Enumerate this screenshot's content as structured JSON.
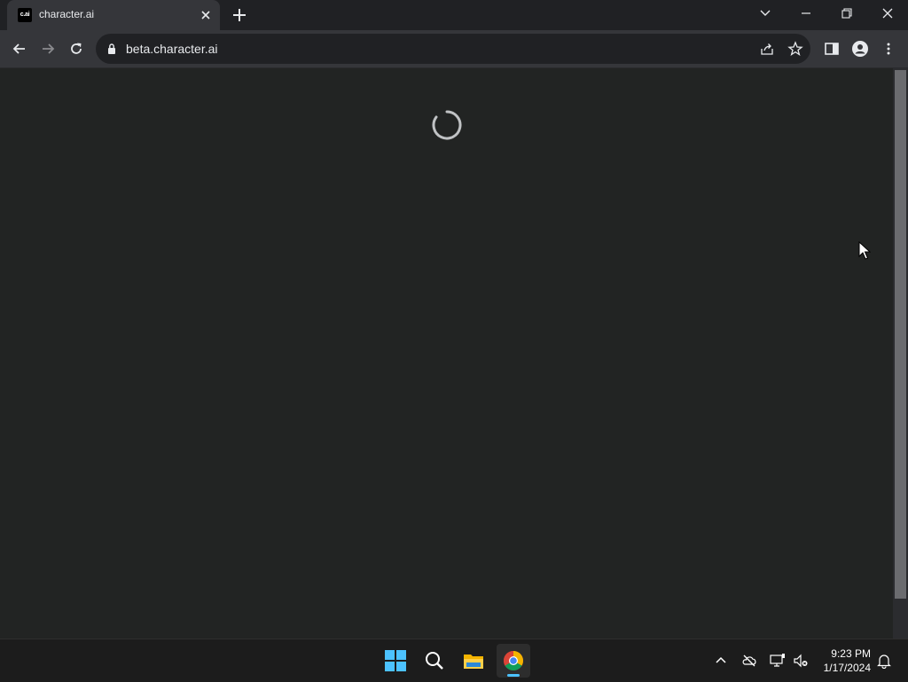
{
  "browser": {
    "tab": {
      "favicon_text": "c.ai",
      "title": "character.ai"
    },
    "url": "beta.character.ai"
  },
  "icons": {
    "tab_close": "close-icon",
    "new_tab": "plus-icon",
    "tab_search": "chevron-down-icon",
    "back": "arrow-left-icon",
    "forward": "arrow-right-icon",
    "reload": "reload-icon",
    "lock": "lock-icon",
    "share": "share-icon",
    "bookmark": "star-icon",
    "side_panel": "side-panel-icon",
    "profile": "profile-icon",
    "menu": "kebab-menu-icon"
  },
  "page": {
    "state": "loading"
  },
  "taskbar": {
    "apps": [
      "start",
      "search",
      "file-explorer",
      "chrome"
    ],
    "time": "9:23 PM",
    "date": "1/17/2024"
  },
  "colors": {
    "titlebar": "#202124",
    "toolbar": "#35363a",
    "page_background": "#222423",
    "taskbar": "#1c1c1c",
    "accent": "#4cc2ff"
  }
}
